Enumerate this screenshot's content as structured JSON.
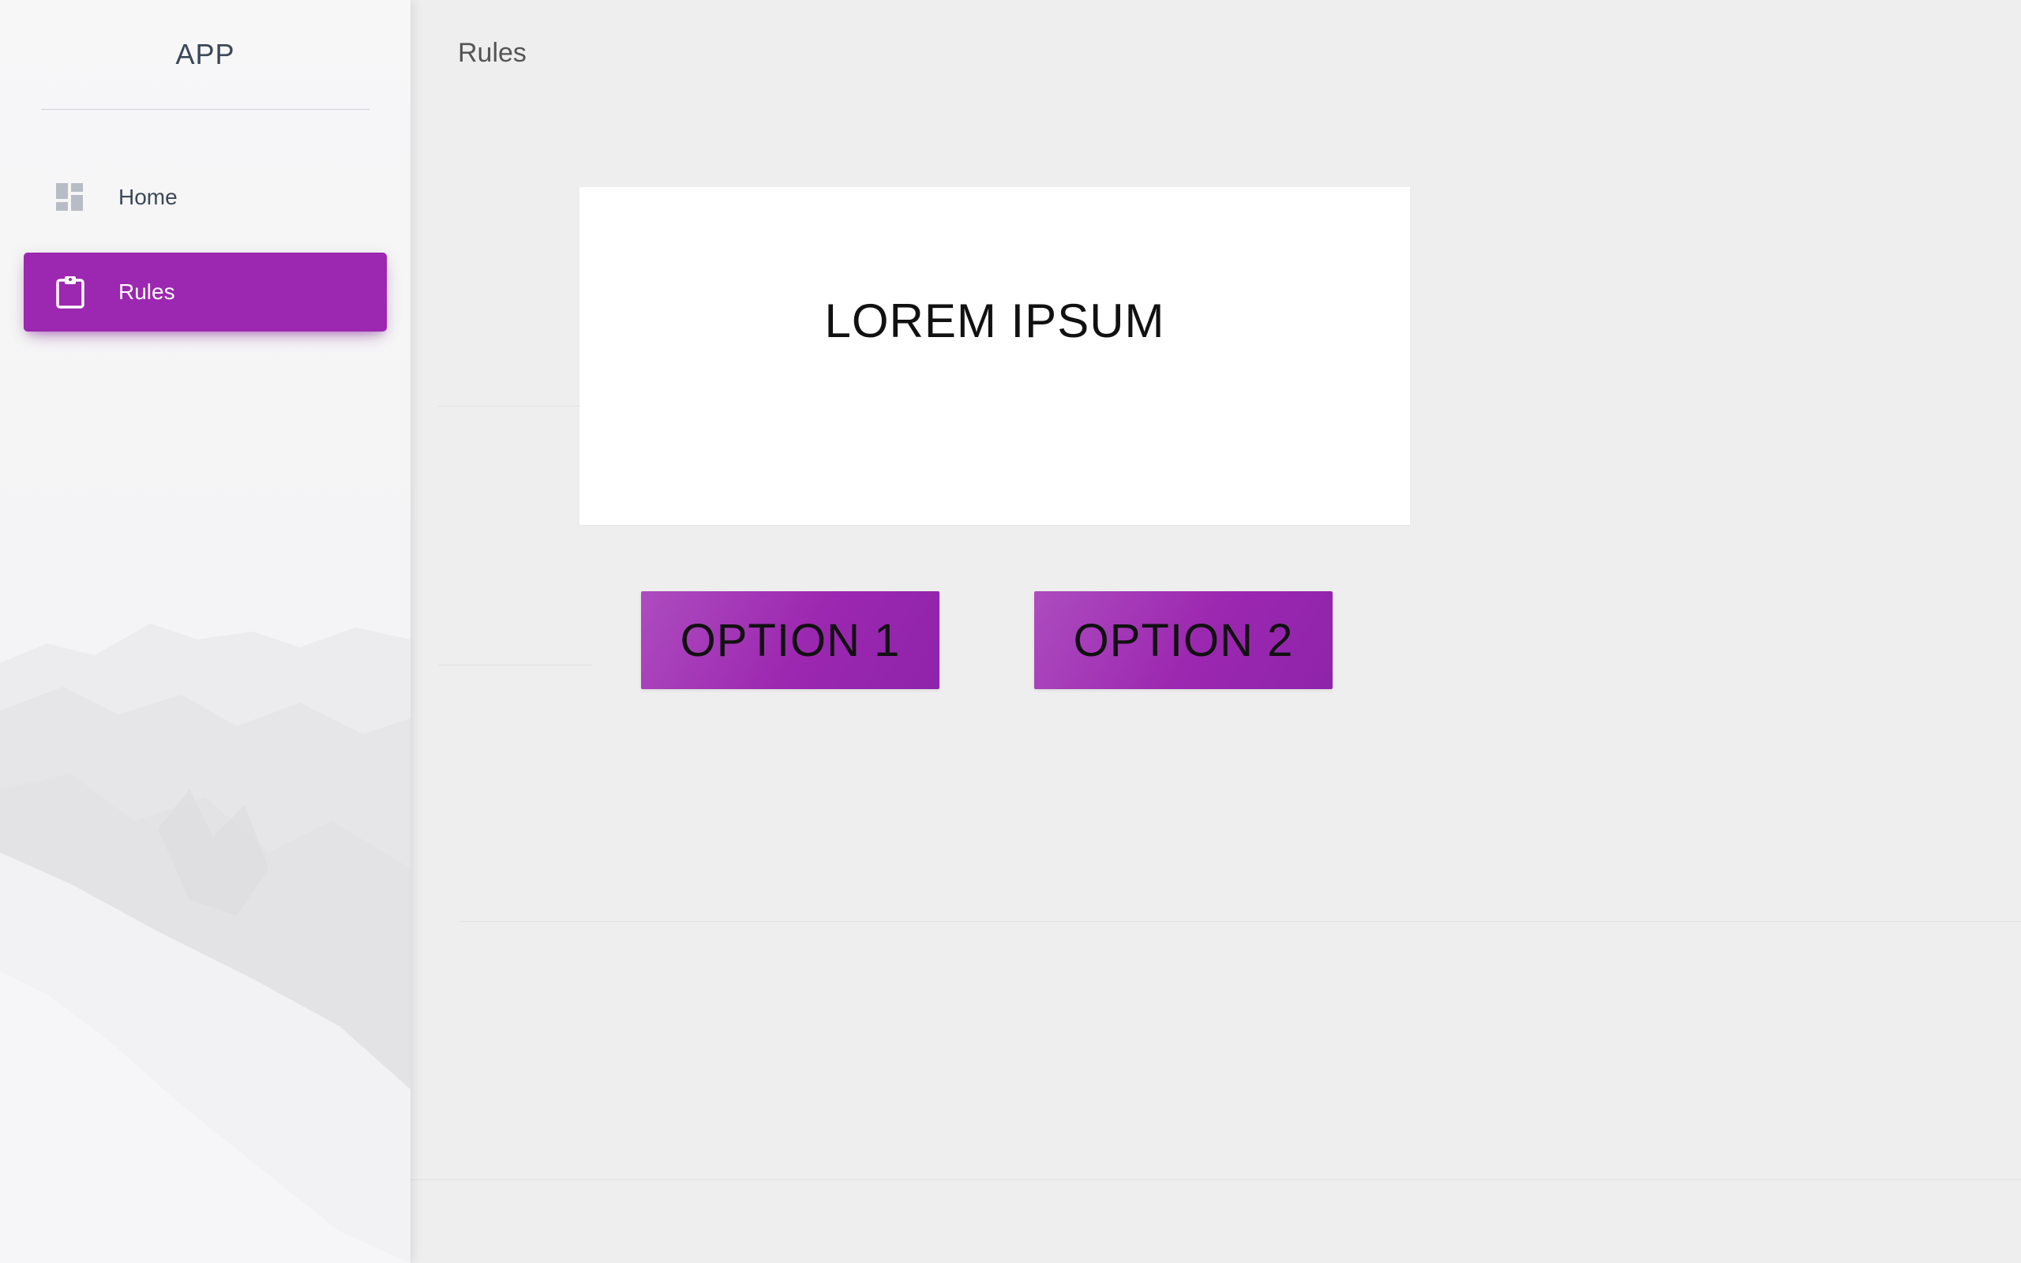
{
  "sidebar": {
    "brand": "APP",
    "items": [
      {
        "label": "Home",
        "icon": "dashboard-icon",
        "active": false
      },
      {
        "label": "Rules",
        "icon": "clipboard-icon",
        "active": true
      }
    ]
  },
  "header": {
    "title": "Rules"
  },
  "card": {
    "title": "LOREM IPSUM"
  },
  "options": [
    {
      "label": "OPTION 1"
    },
    {
      "label": "OPTION 2"
    }
  ],
  "colors": {
    "accent": "#9c27b0",
    "background": "#eeeeee",
    "sidebar_text": "#3c4858"
  }
}
